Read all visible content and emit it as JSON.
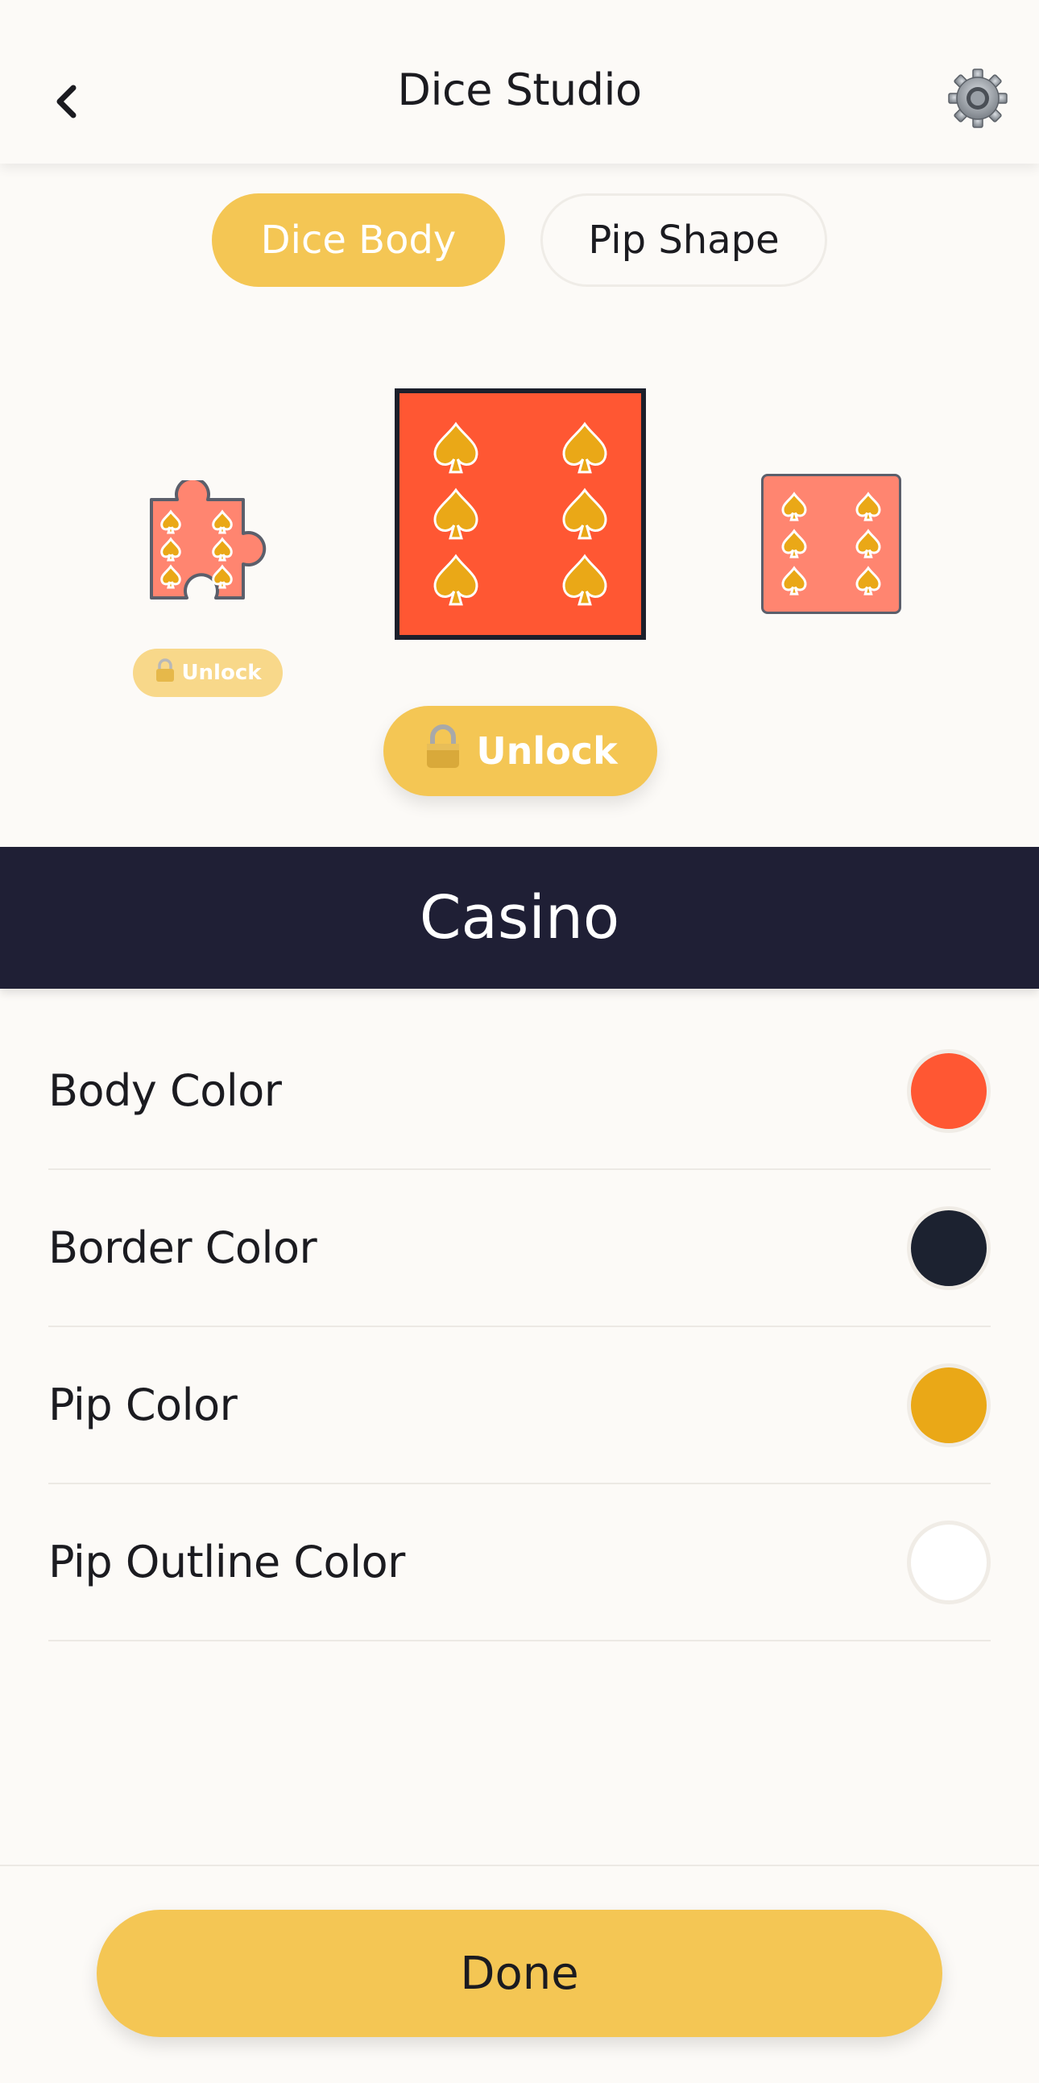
{
  "header": {
    "title": "Dice Studio",
    "back_icon": "chevron-left-icon",
    "settings_icon": "gear-icon"
  },
  "tabs": [
    {
      "label": "Dice Body",
      "active": true
    },
    {
      "label": "Pip Shape",
      "active": false
    }
  ],
  "carousel": {
    "pip_symbol": "spade",
    "previous": {
      "shape": "puzzle-piece",
      "locked": true,
      "unlock_label": "Unlock"
    },
    "current": {
      "shape": "square",
      "locked": true,
      "unlock_label": "Unlock"
    },
    "next": {
      "shape": "rounded-square",
      "locked": false
    }
  },
  "theme_name": "Casino",
  "color_settings": [
    {
      "label": "Body Color",
      "color": "#ff5733"
    },
    {
      "label": "Border Color",
      "color": "#1c2230"
    },
    {
      "label": "Pip Color",
      "color": "#eaa817"
    },
    {
      "label": "Pip Outline Color",
      "color": "#ffffff"
    }
  ],
  "footer": {
    "done_label": "Done"
  },
  "colors": {
    "accent": "#f4c654",
    "banner": "#1f1f35",
    "background": "#fcfaf7"
  }
}
